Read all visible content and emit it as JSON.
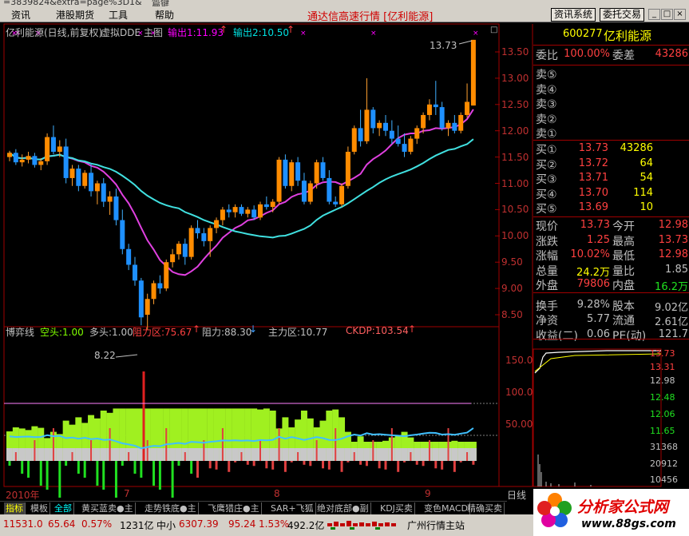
{
  "titlebar": {
    "text": "=3839824&extra=page%3D1&",
    "tab2": "篇键"
  },
  "menu": {
    "items": [
      "资讯",
      "港股期货",
      "工具",
      "帮助"
    ],
    "title": "通达信高速行情 [亿利能源]",
    "btn1": "资讯系统",
    "btn2": "委托交易",
    "win": [
      "_",
      "□",
      "×"
    ]
  },
  "main": {
    "title": "亿利能源(日线,前复权)",
    "tag": "虚拟DDE 主图",
    "out1": "输出1:11.93",
    "out2": "输出2:10.50",
    "high_label": "13.73",
    "low_label": "8.22",
    "yticks": [
      "13.50",
      "13.00",
      "12.50",
      "12.00",
      "11.50",
      "11.00",
      "10.50",
      "10.00",
      "9.50",
      "9.00",
      "8.50"
    ]
  },
  "indicator": {
    "name": "博弈线",
    "kong": "空头:1.00",
    "duo": "多头:1.00",
    "zuli1": "阻力区:75.67",
    "zuli2": "阻力:88.30",
    "zhuli": "主力区:10.77",
    "ckdp": "CKDP:103.54",
    "yticks": [
      "150.0",
      "100.0",
      "50.00"
    ]
  },
  "xaxis": {
    "labels": [
      "2010年",
      "7",
      "8",
      "9"
    ],
    "period": "日线"
  },
  "candles": [
    [
      11.5,
      11.62,
      11.42,
      11.58
    ],
    [
      11.58,
      11.65,
      11.35,
      11.4
    ],
    [
      11.4,
      11.55,
      11.32,
      11.45
    ],
    [
      11.45,
      11.6,
      11.38,
      11.52
    ],
    [
      11.52,
      11.58,
      11.3,
      11.35
    ],
    [
      11.35,
      11.48,
      11.25,
      11.42
    ],
    [
      11.42,
      11.95,
      11.35,
      11.88
    ],
    [
      11.88,
      12.1,
      11.55,
      11.6
    ],
    [
      11.6,
      11.82,
      11.5,
      11.7
    ],
    [
      11.7,
      11.85,
      11.0,
      11.1
    ],
    [
      11.1,
      11.35,
      10.95,
      11.28
    ],
    [
      11.28,
      11.35,
      10.85,
      10.95
    ],
    [
      10.95,
      11.25,
      10.9,
      11.2
    ],
    [
      11.2,
      11.38,
      10.75,
      10.85
    ],
    [
      10.85,
      11.05,
      10.6,
      11.0
    ],
    [
      11.0,
      11.1,
      10.55,
      10.65
    ],
    [
      10.65,
      10.85,
      10.4,
      10.75
    ],
    [
      10.75,
      10.9,
      10.2,
      10.3
    ],
    [
      10.3,
      10.5,
      9.65,
      9.75
    ],
    [
      9.75,
      9.85,
      9.35,
      9.45
    ],
    [
      9.45,
      9.6,
      9.05,
      9.15
    ],
    [
      9.15,
      9.2,
      8.3,
      8.45
    ],
    [
      8.5,
      8.9,
      8.22,
      8.8
    ],
    [
      8.8,
      9.15,
      8.7,
      9.1
    ],
    [
      9.1,
      9.25,
      8.9,
      9.0
    ],
    [
      9.0,
      9.55,
      8.95,
      9.5
    ],
    [
      9.5,
      9.75,
      9.4,
      9.65
    ],
    [
      9.65,
      9.9,
      9.55,
      9.85
    ],
    [
      9.85,
      9.95,
      9.45,
      9.6
    ],
    [
      9.6,
      10.2,
      9.55,
      10.15
    ],
    [
      10.15,
      10.3,
      9.95,
      10.05
    ],
    [
      10.05,
      10.15,
      9.8,
      9.9
    ],
    [
      9.9,
      10.2,
      9.6,
      10.15
    ],
    [
      10.15,
      10.35,
      10.05,
      10.3
    ],
    [
      10.3,
      10.55,
      10.2,
      10.5
    ],
    [
      10.5,
      10.6,
      10.35,
      10.45
    ],
    [
      10.45,
      10.6,
      10.35,
      10.55
    ],
    [
      10.55,
      10.6,
      10.38,
      10.42
    ],
    [
      10.42,
      10.55,
      10.35,
      10.5
    ],
    [
      10.5,
      10.58,
      10.3,
      10.35
    ],
    [
      10.35,
      10.65,
      10.3,
      10.6
    ],
    [
      10.6,
      10.75,
      10.5,
      10.55
    ],
    [
      10.55,
      10.7,
      10.45,
      10.65
    ],
    [
      10.65,
      11.5,
      10.6,
      11.45
    ],
    [
      11.45,
      11.55,
      10.9,
      10.95
    ],
    [
      10.95,
      11.45,
      10.85,
      11.4
    ],
    [
      11.4,
      11.5,
      10.95,
      11.05
    ],
    [
      11.05,
      11.2,
      10.6,
      10.65
    ],
    [
      10.65,
      11.05,
      10.6,
      11.0
    ],
    [
      11.0,
      11.45,
      10.9,
      11.4
    ],
    [
      11.4,
      11.5,
      11.05,
      11.1
    ],
    [
      11.1,
      11.25,
      10.6,
      10.65
    ],
    [
      10.65,
      10.75,
      10.55,
      10.6
    ],
    [
      10.6,
      11.0,
      10.55,
      10.95
    ],
    [
      10.95,
      11.7,
      10.9,
      11.6
    ],
    [
      11.6,
      12.1,
      11.55,
      12.05
    ],
    [
      12.05,
      12.4,
      11.7,
      11.8
    ],
    [
      11.8,
      13.0,
      11.75,
      12.4
    ],
    [
      12.4,
      12.45,
      11.95,
      12.05
    ],
    [
      12.05,
      12.2,
      11.9,
      12.15
    ],
    [
      12.15,
      12.3,
      11.9,
      12.0
    ],
    [
      12.0,
      12.2,
      11.75,
      11.85
    ],
    [
      11.85,
      12.1,
      11.7,
      11.75
    ],
    [
      11.75,
      11.95,
      11.5,
      11.6
    ],
    [
      11.6,
      11.9,
      11.55,
      11.85
    ],
    [
      11.85,
      12.1,
      11.75,
      12.05
    ],
    [
      12.05,
      12.35,
      11.95,
      12.3
    ],
    [
      12.3,
      12.6,
      12.2,
      12.5
    ],
    [
      12.5,
      12.95,
      12.3,
      12.45
    ],
    [
      12.45,
      12.55,
      12.0,
      12.05
    ],
    [
      12.05,
      12.2,
      11.9,
      12.15
    ],
    [
      12.15,
      12.3,
      11.95,
      12.0
    ],
    [
      12.0,
      12.35,
      11.95,
      12.3
    ],
    [
      12.3,
      12.9,
      12.25,
      12.55
    ],
    [
      12.48,
      13.73,
      12.48,
      13.73
    ]
  ],
  "quote": {
    "code": "600277",
    "name": "亿利能源",
    "weibi_lbl": "委比",
    "weibi": "100.00%",
    "weicha_lbl": "委差",
    "weicha": "43286",
    "sell": [
      [
        "卖⑤",
        "",
        ""
      ],
      [
        "卖④",
        "",
        ""
      ],
      [
        "卖③",
        "",
        ""
      ],
      [
        "卖②",
        "",
        ""
      ],
      [
        "卖①",
        "",
        ""
      ]
    ],
    "buy": [
      [
        "买①",
        "13.73",
        "43286"
      ],
      [
        "买②",
        "13.72",
        "64"
      ],
      [
        "买③",
        "13.71",
        "54"
      ],
      [
        "买④",
        "13.70",
        "114"
      ],
      [
        "买⑤",
        "13.69",
        "10"
      ]
    ],
    "rows": [
      [
        "现价",
        "13.73",
        "今开",
        "12.98"
      ],
      [
        "涨跌",
        "1.25",
        "最高",
        "13.73"
      ],
      [
        "涨幅",
        "10.02%",
        "最低",
        "12.98"
      ],
      [
        "总量",
        "24.2万",
        "量比",
        "1.85"
      ],
      [
        "外盘",
        "79806",
        "内盘",
        "16.2万"
      ],
      [
        "换手",
        "9.28%",
        "股本",
        "9.02亿"
      ],
      [
        "净资",
        "5.77",
        "流通",
        "2.61亿"
      ],
      [
        "收益(二)",
        "0.06",
        "PE(动)",
        "121.7"
      ]
    ],
    "mini_ticks": [
      "13.73",
      "13.31",
      "12.98",
      "12.48",
      "12.06",
      "11.65",
      "31368",
      "20912",
      "10456"
    ]
  },
  "tabs": [
    "指标",
    "模板",
    "全部",
    "黄买蓝卖●主",
    "走势铁底●主",
    "飞鹰猎庄●主",
    "SAR+飞狐",
    "绝对底部●副",
    "KDJ买卖",
    "变色MACD",
    "精确买卖"
  ],
  "status": {
    "idx1": "11531.0",
    "idx1_chg": "65.64",
    "idx1_pct": "0.57%",
    "idx1_amt": "1231亿",
    "idx2_name": "中小",
    "idx2": "6307.39",
    "idx2_chg": "95.24",
    "idx2_pct": "1.53%",
    "idx2_amt": "492.2亿",
    "station": "广州行情主站"
  },
  "logo": {
    "text": "分析家公式网",
    "url": "www.88gs.com"
  }
}
